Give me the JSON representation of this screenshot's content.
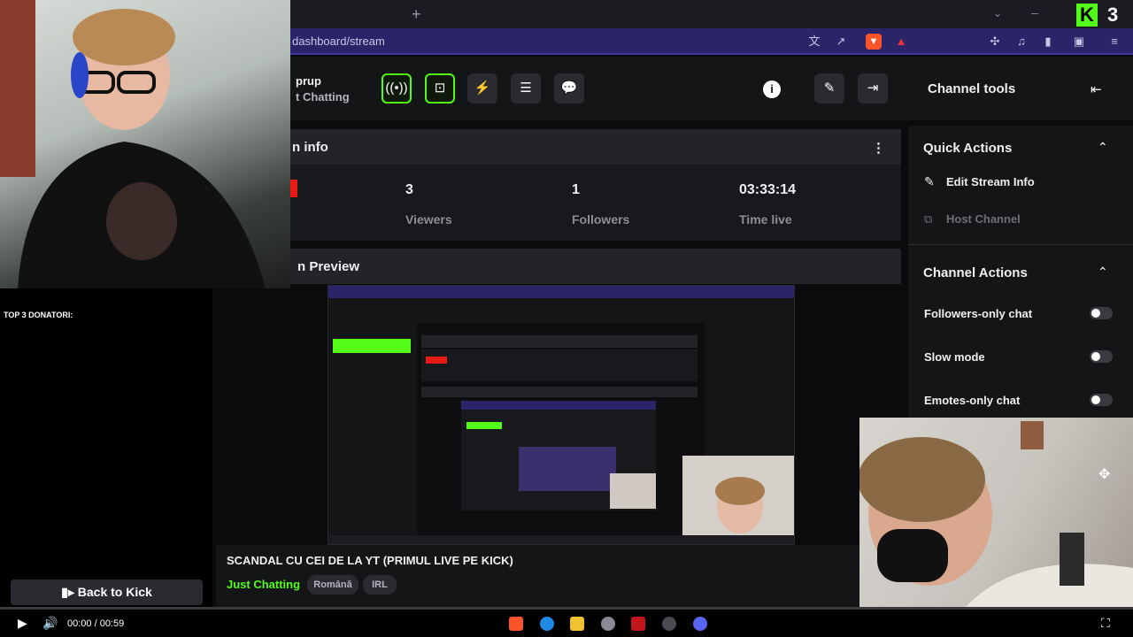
{
  "browser": {
    "url": "dashboard/stream",
    "new_tab": "+",
    "kick_logo": "K",
    "tab_count": "3"
  },
  "dashboard": {
    "channel_name": "prup",
    "channel_category": "t Chatting",
    "header_icons": [
      "broadcast-icon",
      "capture-icon",
      "lightning-icon",
      "document-icon",
      "chat-icon",
      "info-icon",
      "pencil-icon",
      "exit-icon"
    ],
    "channel_tools_title": "Channel tools"
  },
  "session": {
    "title": "n info",
    "menu": "⋮",
    "stats": [
      {
        "value": "3",
        "label": "Viewers"
      },
      {
        "value": "1",
        "label": "Followers"
      },
      {
        "value": "03:33:14",
        "label": "Time live"
      }
    ]
  },
  "preview": {
    "title": "n Preview"
  },
  "tools": {
    "quick_actions_title": "Quick Actions",
    "quick_actions": [
      {
        "label": "Edit Stream Info",
        "icon": "pencil-icon",
        "enabled": true
      },
      {
        "label": "Host Channel",
        "icon": "host-icon",
        "enabled": false
      }
    ],
    "channel_actions_title": "Channel Actions",
    "channel_actions": [
      {
        "label": "Followers-only chat",
        "on": false
      },
      {
        "label": "Slow mode",
        "on": false
      },
      {
        "label": "Emotes-only chat",
        "on": false
      }
    ]
  },
  "overlay": {
    "top_donors": "TOP 3 DONATORI:",
    "back_to_kick": "Back to Kick"
  },
  "stream": {
    "title": "SCANDAL CU CEI DE LA YT (PRIMUL LIVE PE KICK)",
    "category": "Just Chatting",
    "tags": [
      "Română",
      "IRL"
    ]
  },
  "player": {
    "time": "00:00 / 00:59",
    "progress": 0
  },
  "colors": {
    "kick_green": "#53fc18",
    "url_bar": "#2a2468",
    "panel": "#1d1e22"
  }
}
